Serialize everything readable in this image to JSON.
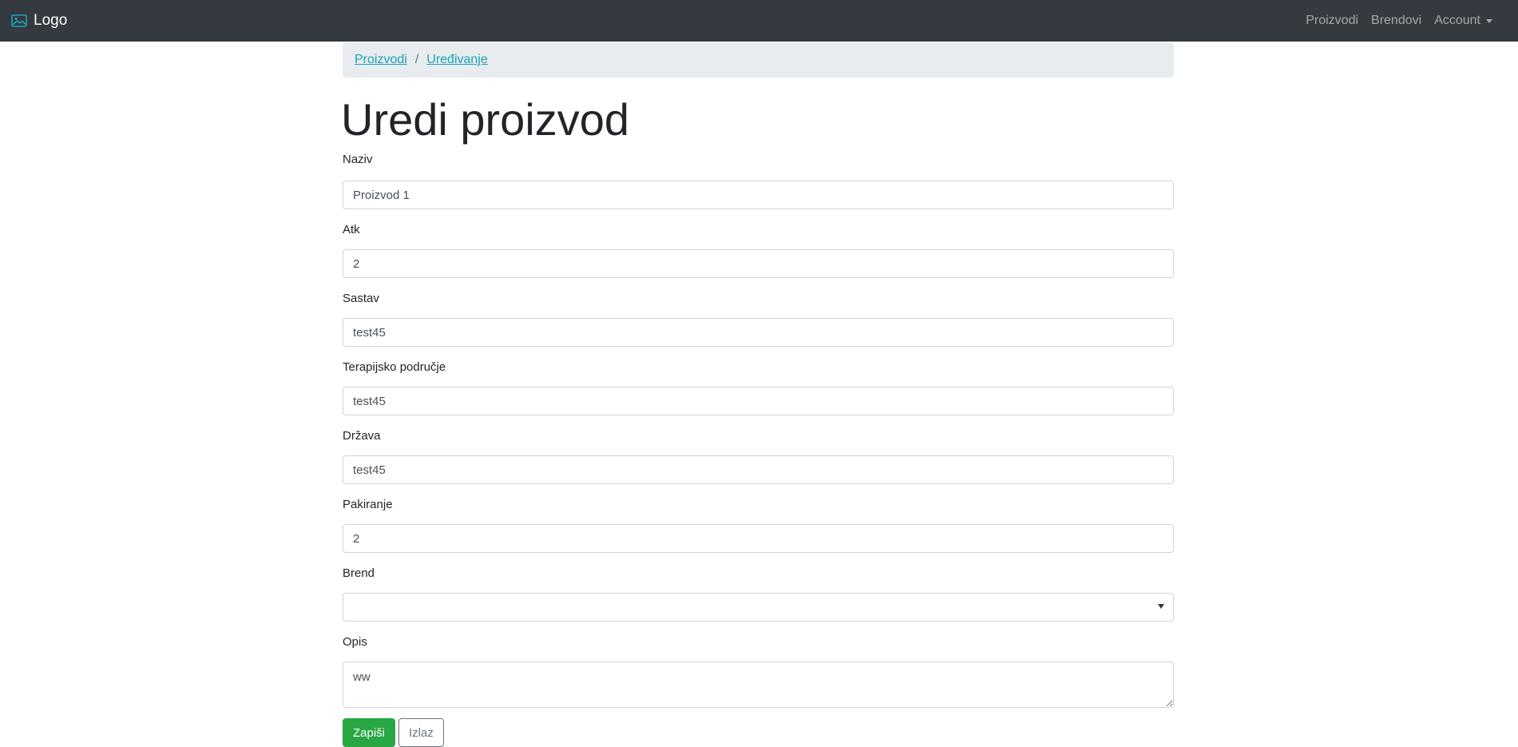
{
  "navbar": {
    "brand_label": "Logo",
    "links": [
      {
        "label": "Proizvodi"
      },
      {
        "label": "Brendovi"
      },
      {
        "label": "Account"
      }
    ]
  },
  "breadcrumb": {
    "items": [
      {
        "label": "Proizvodi"
      },
      {
        "label": "Uređivanje"
      }
    ],
    "separator": "/"
  },
  "page_title": "Uredi proizvod",
  "form": {
    "naziv": {
      "label": "Naziv",
      "value": "Proizvod 1"
    },
    "atk": {
      "label": "Atk",
      "value": "2"
    },
    "sastav": {
      "label": "Sastav",
      "value": "test45"
    },
    "terapijsko": {
      "label": "Terapijsko područje",
      "value": "test45"
    },
    "drzava": {
      "label": "Država",
      "value": "test45"
    },
    "pakiranje": {
      "label": "Pakiranje",
      "value": "2"
    },
    "brend": {
      "label": "Brend",
      "value": ""
    },
    "opis": {
      "label": "Opis",
      "value": "ww"
    }
  },
  "buttons": {
    "save_label": "Zapiši",
    "exit_label": "Izlaz"
  },
  "colors": {
    "navbar_bg": "#343a40",
    "link": "#17a2b8",
    "success": "#28a745"
  }
}
